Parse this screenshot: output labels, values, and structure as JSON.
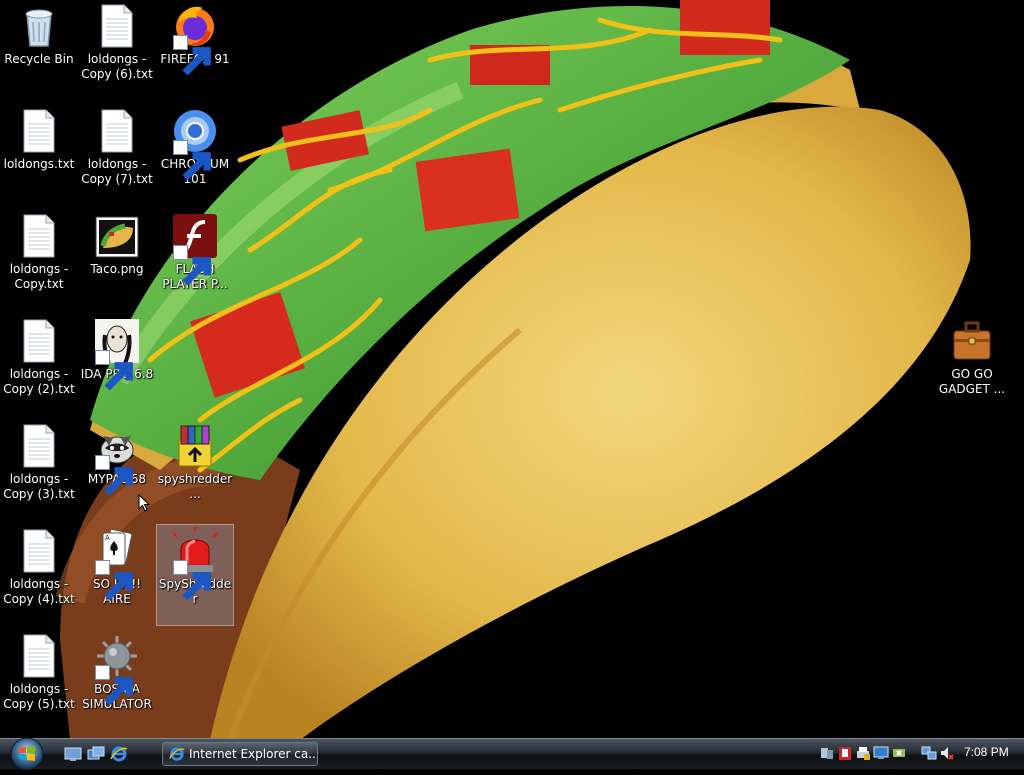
{
  "desktop": {
    "icons": [
      {
        "label": "Recycle Bin",
        "icon": "recycle-bin-icon"
      },
      {
        "label": "loldongs - Copy (6).txt",
        "icon": "text-file-icon"
      },
      {
        "label": "FIREFOX 91",
        "icon": "firefox-icon"
      },
      {
        "label": "loldongs.txt",
        "icon": "text-file-icon"
      },
      {
        "label": "loldongs - Copy (7).txt",
        "icon": "text-file-icon"
      },
      {
        "label": "CHROMIUM 101",
        "icon": "chromium-icon"
      },
      {
        "label": "loldongs - Copy.txt",
        "icon": "text-file-icon"
      },
      {
        "label": "Taco.png",
        "icon": "taco-image-icon"
      },
      {
        "label": "FLASH PLAYER P...",
        "icon": "flash-player-icon"
      },
      {
        "label": "loldongs - Copy (2).txt",
        "icon": "text-file-icon"
      },
      {
        "label": "IDA PRO 6.8",
        "icon": "ida-pro-icon"
      },
      {
        "label": "loldongs - Copy (3).txt",
        "icon": "text-file-icon"
      },
      {
        "label": "MYPAL 68",
        "icon": "mypal-raccoon-icon"
      },
      {
        "label": "spyshredder...",
        "icon": "winrar-archive-icon"
      },
      {
        "label": "loldongs - Copy (4).txt",
        "icon": "text-file-icon"
      },
      {
        "label": "SO LIT!! AIRE",
        "icon": "solitaire-cards-icon"
      },
      {
        "label": "SpyShredder",
        "icon": "spyshredder-alarm-icon"
      },
      {
        "label": "loldongs - Copy (5).txt",
        "icon": "text-file-icon"
      },
      {
        "label": "BOSNIA SIMULATOR",
        "icon": "spiked-mine-icon"
      },
      {
        "label": "GO GO GADGET ...",
        "icon": "briefcase-icon"
      }
    ]
  },
  "taskbar": {
    "start_button": "start-orb-icon",
    "quicklaunch": [
      "show-desktop-icon",
      "switch-windows-icon",
      "internet-explorer-icon"
    ],
    "tasks": [
      {
        "label": "Internet Explorer ca...",
        "icon": "internet-explorer-icon"
      }
    ],
    "tray_icons": [
      "network-icon",
      "security-alert-icon",
      "printer-icon",
      "monitor-icon",
      "safely-remove-icon",
      "network-connection-icon",
      "volume-muted-icon"
    ],
    "clock": "7:08 PM"
  },
  "colors": {
    "desktop_bg": "#000000",
    "taskbar": "#1a1f25",
    "label_text": "#ffffff"
  }
}
